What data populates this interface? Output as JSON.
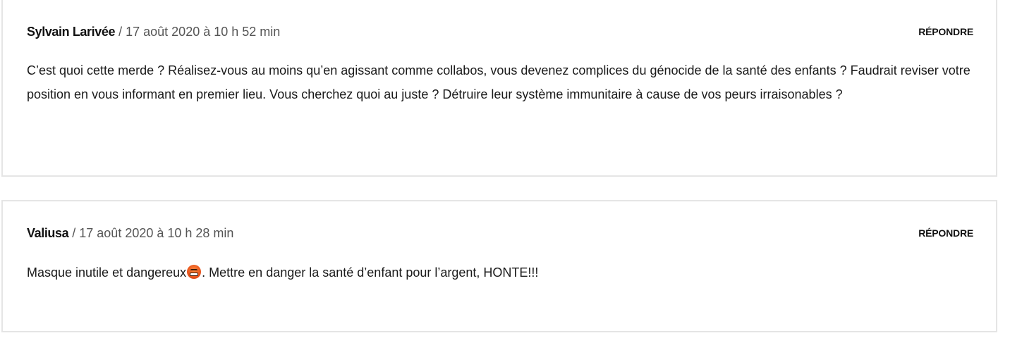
{
  "comments": [
    {
      "author": "Sylvain Larivée",
      "separator": " / ",
      "date": "17 août 2020 à 10 h 52 min",
      "reply_label": "RÉPONDRE",
      "text": "C’est quoi cette merde ? Réalisez-vous au moins qu’en agissant comme collabos, vous devenez complices du génocide de la santé des enfants ? Faudrait reviser votre position en vous informant en premier lieu. Vous cherchez quoi au juste ? Détruire leur système immunitaire à cause de vos peurs irraisonables ?"
    },
    {
      "author": "Valiusa",
      "separator": " / ",
      "date": "17 août 2020 à 10 h 28 min",
      "reply_label": "RÉPONDRE",
      "text_before_emoji": "Masque inutile et dangereux",
      "emoji": "angry-face-icon",
      "text_after_emoji": ". Mettre en danger la santé d’enfant pour l’argent, HONTE!!!"
    }
  ]
}
